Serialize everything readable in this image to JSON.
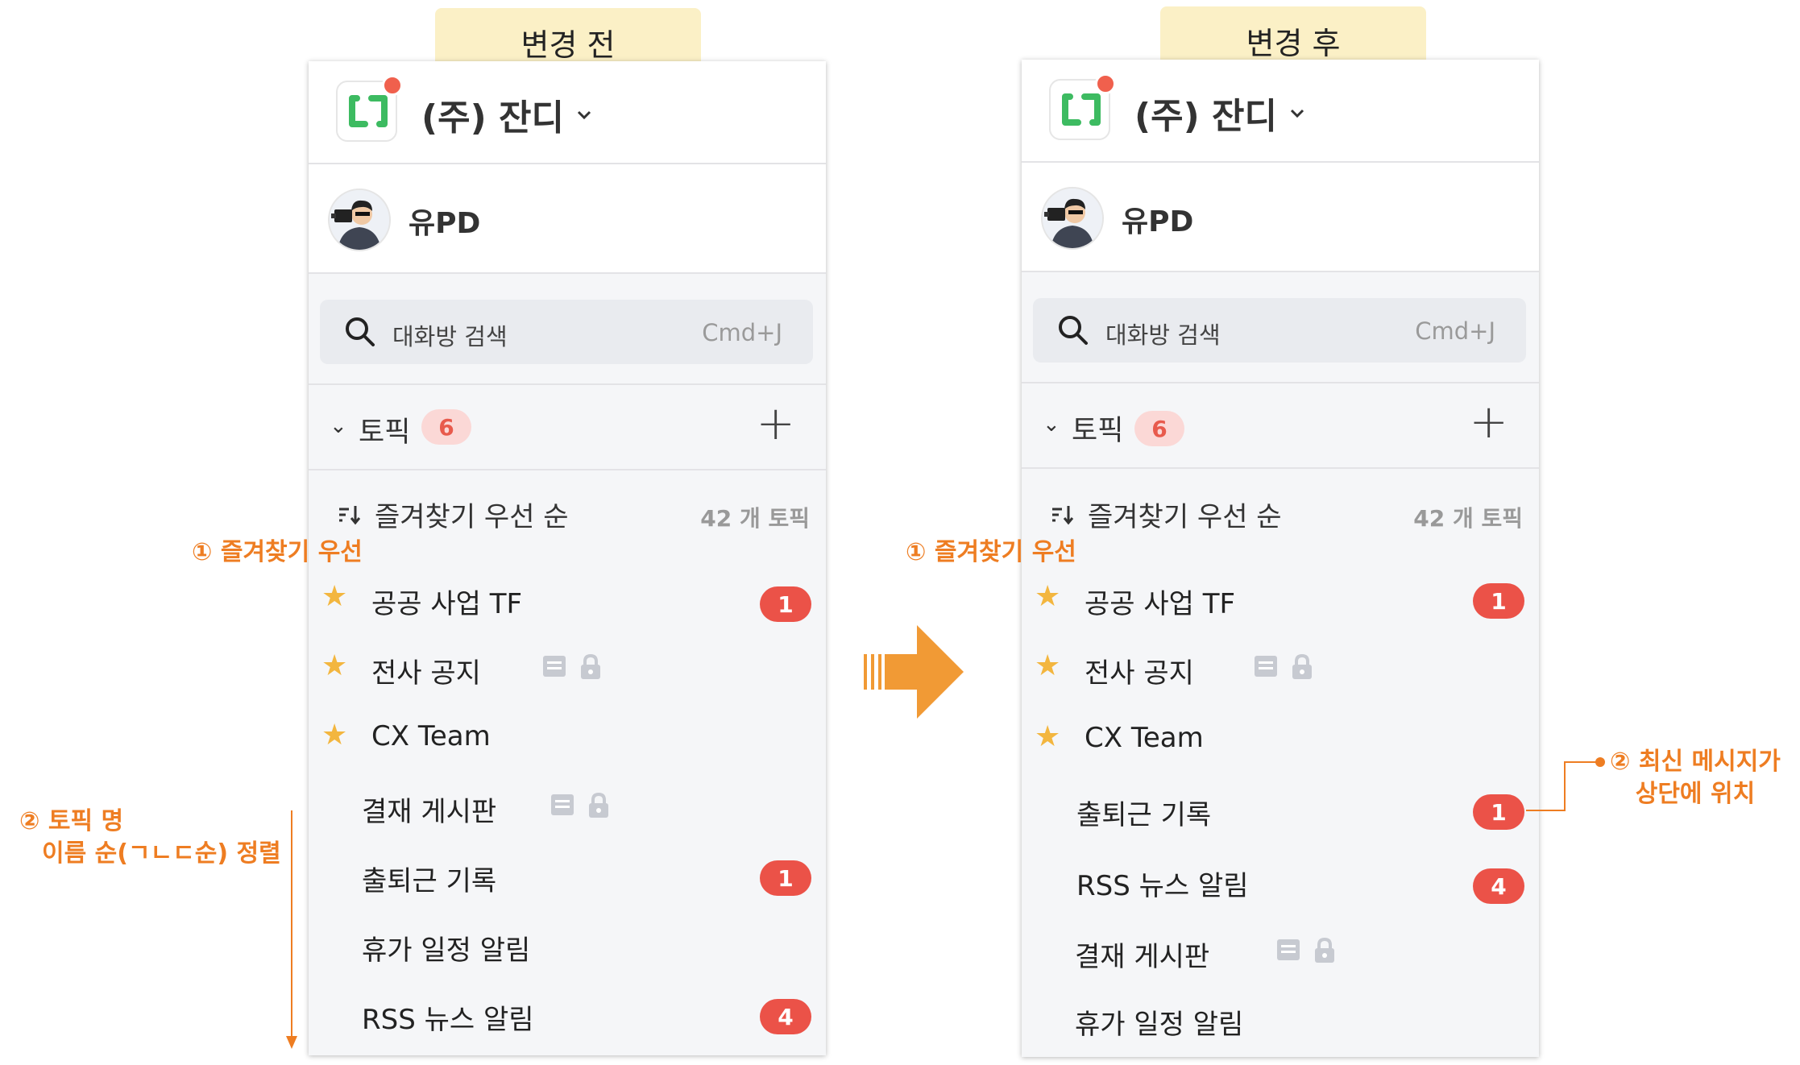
{
  "before": {
    "tab_label": "변경 전",
    "workspace": "(주) 잔디",
    "user": "유PD",
    "search": {
      "placeholder": "대화방 검색",
      "shortcut": "Cmd+J"
    },
    "topics": {
      "title": "토픽",
      "count": "6",
      "add": "+"
    },
    "sort": {
      "label": "즐겨찾기 우선 순",
      "total": "42 개 토픽"
    },
    "items": [
      {
        "name": "공공 사업 TF",
        "favorite": true,
        "badge": "1"
      },
      {
        "name": "전사 공지",
        "favorite": true,
        "icons": [
          "board-icon",
          "lock-icon"
        ]
      },
      {
        "name": "CX Team",
        "favorite": true
      },
      {
        "name": "결재 게시판",
        "favorite": false,
        "icons": [
          "board-icon",
          "lock-icon"
        ]
      },
      {
        "name": "출퇴근 기록",
        "favorite": false,
        "badge": "1"
      },
      {
        "name": "휴가 일정 알림",
        "favorite": false
      },
      {
        "name": "RSS 뉴스 알림",
        "favorite": false,
        "badge": "4"
      }
    ],
    "annotations": {
      "favorite_first": "① 즐겨찾기 우선",
      "name_sort_line1": "② 토픽 명",
      "name_sort_line2": "이름 순(ㄱㄴㄷ순) 정렬"
    }
  },
  "after": {
    "tab_label": "변경 후",
    "workspace": "(주) 잔디",
    "user": "유PD",
    "search": {
      "placeholder": "대화방 검색",
      "shortcut": "Cmd+J"
    },
    "topics": {
      "title": "토픽",
      "count": "6",
      "add": "+"
    },
    "sort": {
      "label": "즐겨찾기 우선 순",
      "total": "42 개 토픽"
    },
    "items": [
      {
        "name": "공공 사업 TF",
        "favorite": true,
        "badge": "1"
      },
      {
        "name": "전사 공지",
        "favorite": true,
        "icons": [
          "board-icon",
          "lock-icon"
        ]
      },
      {
        "name": "CX Team",
        "favorite": true
      },
      {
        "name": "출퇴근 기록",
        "favorite": false,
        "badge": "1"
      },
      {
        "name": "RSS 뉴스 알림",
        "favorite": false,
        "badge": "4"
      },
      {
        "name": "결재 게시판",
        "favorite": false,
        "icons": [
          "board-icon",
          "lock-icon"
        ]
      },
      {
        "name": "휴가 일정 알림",
        "favorite": false
      }
    ],
    "annotations": {
      "favorite_first": "① 즐겨찾기 우선",
      "recent_line1": "② 최신 메시지가",
      "recent_line2": "상단에 위치"
    }
  },
  "colors": {
    "accent_orange": "#ee7d22",
    "badge_red": "#eb5248",
    "star": "#f3b63f",
    "brand_green": "#3dbb61"
  }
}
